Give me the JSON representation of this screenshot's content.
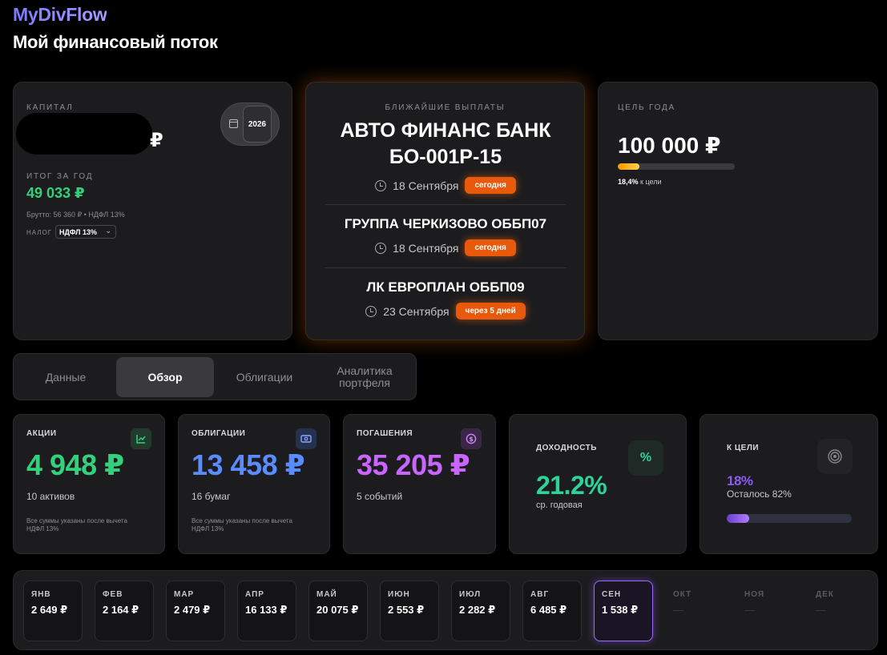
{
  "header": {
    "brand": "MyDivFlow",
    "title": "Мой финансовый поток"
  },
  "capital": {
    "label": "КАПИТАЛ",
    "currency": "₽",
    "year": "2026",
    "total_label": "ИТОГ ЗА ГОД",
    "total_value": "49 033 ₽",
    "gross_note": "Брутто: 56 360 ₽ • НДФЛ 13%",
    "tax_label": "НАЛОГ",
    "tax_value": "НДФЛ 13%"
  },
  "payments": {
    "label": "БЛИЖАЙШИЕ ВЫПЛАТЫ",
    "items": [
      {
        "name": "АВТО ФИНАНС БАНК БО-001Р-15",
        "date": "18 Сентября",
        "badge": "сегодня"
      },
      {
        "name": "ГРУППА ЧЕРКИЗОВО ОББП07",
        "date": "18 Сентября",
        "badge": "сегодня"
      },
      {
        "name": "ЛК ЕВРОПЛАН ОББП09",
        "date": "23 Сентября",
        "badge": "через 5 дней"
      }
    ]
  },
  "goal": {
    "label": "ЦЕЛЬ ГОДА",
    "value": "100 000 ₽",
    "progress_pct": "18,4%",
    "progress_suffix": "к цели",
    "progress_fraction": 0.184
  },
  "tabs": [
    {
      "label": "Данные",
      "active": false
    },
    {
      "label": "Обзор",
      "active": true
    },
    {
      "label": "Облигации",
      "active": false
    },
    {
      "label": "Аналитика портфеля",
      "active": false
    }
  ],
  "stats": {
    "stocks": {
      "label": "АКЦИИ",
      "value": "4 948 ₽",
      "sub": "10 активов",
      "note": "Все суммы указаны после вычета НДФЛ 13%",
      "color": "#34d17c",
      "icon": "chart-line-icon"
    },
    "bonds": {
      "label": "ОБЛИГАЦИИ",
      "value": "13 458 ₽",
      "sub": "16 бумаг",
      "note": "Все суммы указаны после вычета НДФЛ 13%",
      "color": "#5b8cff",
      "icon": "banknote-icon"
    },
    "redemptions": {
      "label": "ПОГАШЕНИЯ",
      "value": "35 205 ₽",
      "sub": "5 событий",
      "color": "#c965ff",
      "icon": "dollar-circle-icon"
    },
    "yield": {
      "label": "ДОХОДНОСТЬ",
      "value": "21.2%",
      "sub": "ср. годовая",
      "color": "#2ed39a",
      "icon": "percent-icon"
    },
    "to_goal": {
      "label": "К ЦЕЛИ",
      "value": "18%",
      "sub": "Осталось 82%",
      "color": "#8a5cf0",
      "icon": "target-icon",
      "fraction": 0.18
    }
  },
  "months": [
    {
      "name": "ЯНВ",
      "value": "2 649 ₽",
      "state": "past"
    },
    {
      "name": "ФЕВ",
      "value": "2 164 ₽",
      "state": "past"
    },
    {
      "name": "МАР",
      "value": "2 479 ₽",
      "state": "past"
    },
    {
      "name": "АПР",
      "value": "16 133 ₽",
      "state": "past"
    },
    {
      "name": "МАЙ",
      "value": "20 075 ₽",
      "state": "past"
    },
    {
      "name": "ИЮН",
      "value": "2 553 ₽",
      "state": "past"
    },
    {
      "name": "ИЮЛ",
      "value": "2 282 ₽",
      "state": "past"
    },
    {
      "name": "АВГ",
      "value": "6 485 ₽",
      "state": "past"
    },
    {
      "name": "СЕН",
      "value": "1 538 ₽",
      "state": "current"
    },
    {
      "name": "ОКТ",
      "value": "—",
      "state": "future"
    },
    {
      "name": "НОЯ",
      "value": "—",
      "state": "future"
    },
    {
      "name": "ДЕК",
      "value": "—",
      "state": "future"
    }
  ]
}
